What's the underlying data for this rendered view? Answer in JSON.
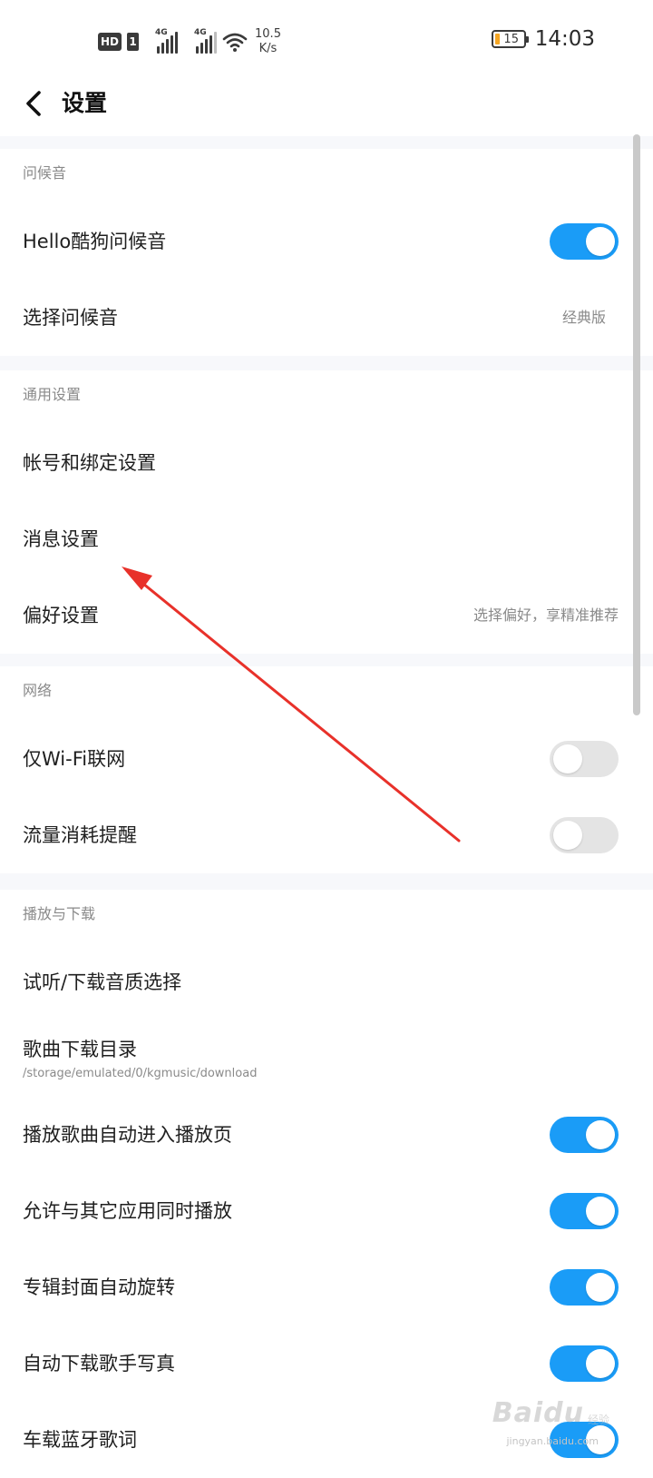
{
  "status_bar": {
    "hd_label": "HD",
    "sim_label": "1",
    "net_type_1": "4G",
    "net_type_2": "4G",
    "speed_value": "10.5",
    "speed_unit": "K/s",
    "battery_level": "15",
    "time": "14:03",
    "icons": [
      "signal-icon",
      "wifi-icon",
      "battery-icon"
    ]
  },
  "header": {
    "title": "设置",
    "back_icon": "chevron-left-icon"
  },
  "colors": {
    "toggle_on": "#1a9cf7",
    "toggle_off": "#e4e4e4",
    "section_gap": "#f7f8fb",
    "annotation_arrow": "#e8312a",
    "battery_fill": "#f5a623"
  },
  "sections": {
    "greeting": {
      "title": "问候音",
      "hello_label": "Hello酷狗问候音",
      "hello_on": true,
      "choose_label": "选择问候音",
      "choose_value": "经典版"
    },
    "general": {
      "title": "通用设置",
      "account_label": "帐号和绑定设置",
      "message_label": "消息设置",
      "preference_label": "偏好设置",
      "preference_value": "选择偏好，享精准推荐"
    },
    "network": {
      "title": "网络",
      "wifi_only_label": "仅Wi-Fi联网",
      "wifi_only_on": false,
      "data_alert_label": "流量消耗提醒",
      "data_alert_on": false
    },
    "playback": {
      "title": "播放与下载",
      "quality_label": "试听/下载音质选择",
      "download_dir_label": "歌曲下载目录",
      "download_dir_path": "/storage/emulated/0/kgmusic/download",
      "auto_play_page_label": "播放歌曲自动进入播放页",
      "auto_play_page_on": true,
      "mix_play_label": "允许与其它应用同时播放",
      "mix_play_on": true,
      "cover_rotate_label": "专辑封面自动旋转",
      "cover_rotate_on": true,
      "auto_download_photo_label": "自动下载歌手写真",
      "auto_download_photo_on": true,
      "car_bt_lyrics_label": "车载蓝牙歌词",
      "car_bt_lyrics_on": true
    }
  },
  "watermark": {
    "main": "Baidu",
    "sub": "经验",
    "domain": "jingyan.baidu.com"
  }
}
